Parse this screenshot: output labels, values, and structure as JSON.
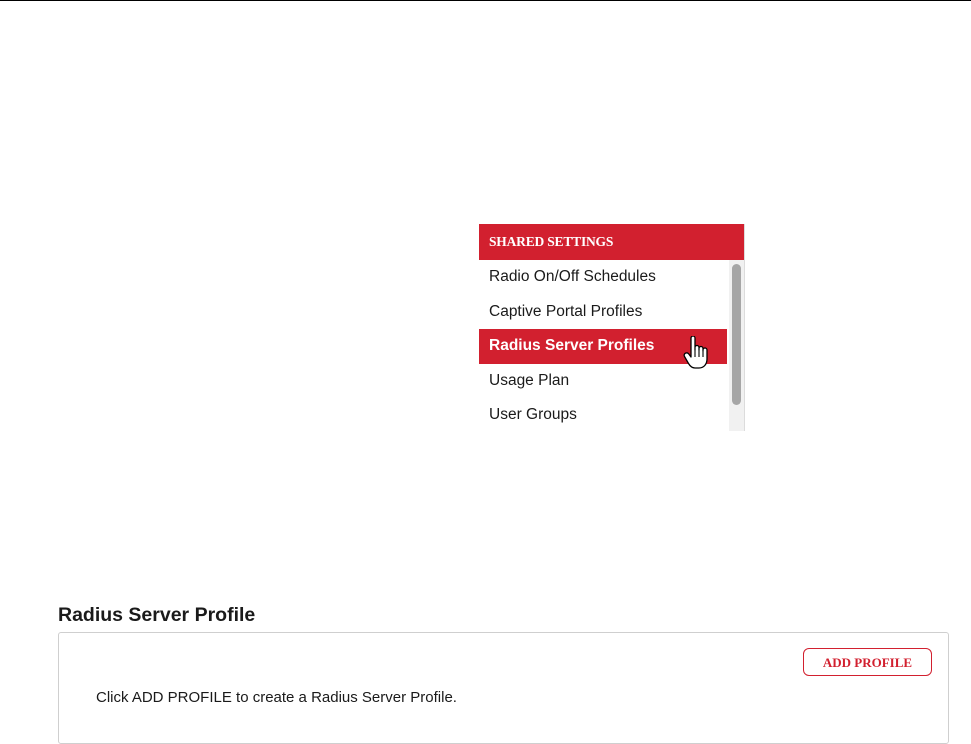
{
  "menu": {
    "header": "SHARED SETTINGS",
    "items": [
      {
        "label": "Radio On/Off Schedules",
        "selected": false
      },
      {
        "label": "Captive Portal Profiles",
        "selected": false
      },
      {
        "label": "Radius Server Profiles",
        "selected": true
      },
      {
        "label": "Usage Plan",
        "selected": false
      },
      {
        "label": "User Groups",
        "selected": false
      }
    ]
  },
  "section": {
    "title": "Radius Server Profile",
    "add_button_label": "ADD PROFILE",
    "hint": "Click ADD PROFILE to create a Radius Server Profile."
  },
  "colors": {
    "accent": "#d2202f",
    "text": "#1a1a1a",
    "border": "#cfcfcf"
  },
  "icons": {
    "cursor": "hand-pointer-icon"
  }
}
